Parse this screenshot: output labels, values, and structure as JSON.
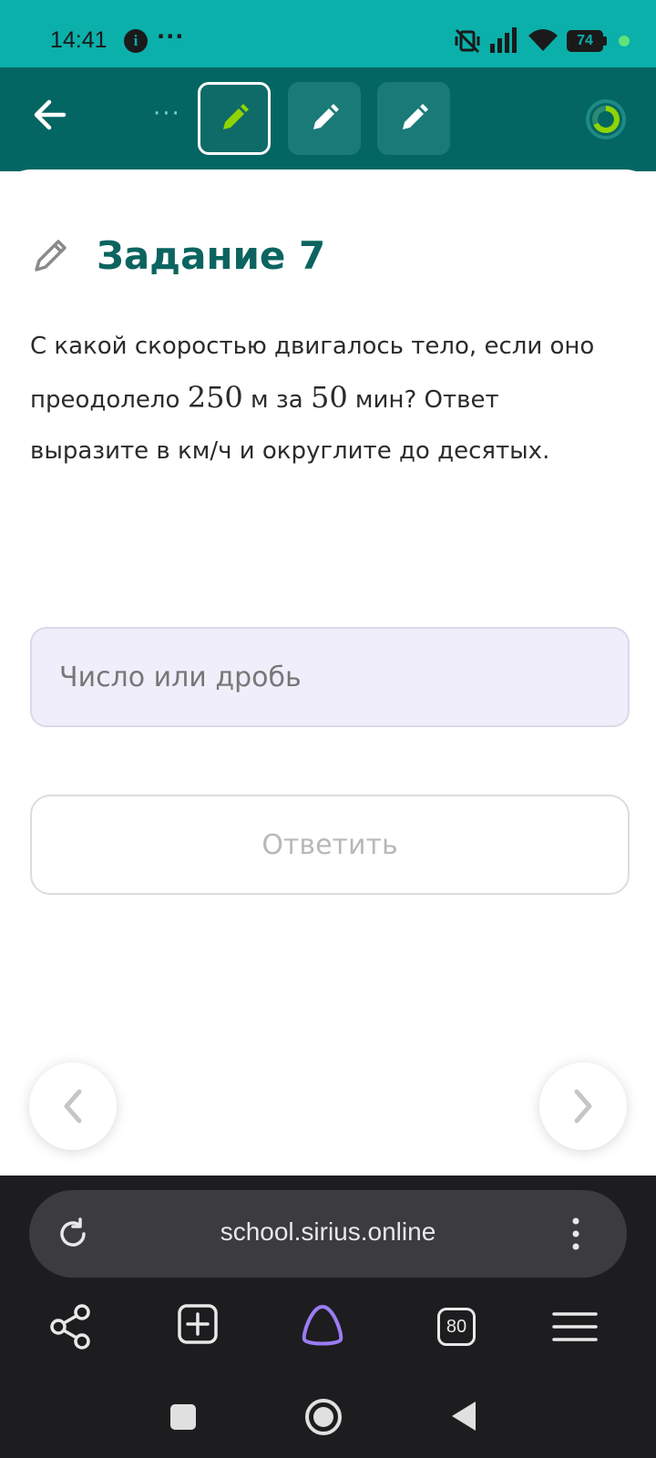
{
  "status_bar": {
    "time": "14:41",
    "battery": "74",
    "more": "···"
  },
  "header": {
    "more_dots": "···"
  },
  "task": {
    "title": "Задание 7",
    "question_part1": "С какой скоростью двигалось тело, если оно преодолело ",
    "distance_value": "250",
    "question_part2": " м за ",
    "time_value": "50",
    "question_part3": " мин? Ответ выразите в км/ч и округлите до десятых."
  },
  "answer": {
    "placeholder": "Число или дробь",
    "submit_label": "Ответить"
  },
  "browser": {
    "url": "school.sirius.online",
    "tabs_count": "80"
  },
  "colors": {
    "status_bar": "#0bb0aa",
    "header": "#046663",
    "title": "#0c6460",
    "active_pencil": "#8fd400",
    "input_bg": "#f0eefa"
  }
}
